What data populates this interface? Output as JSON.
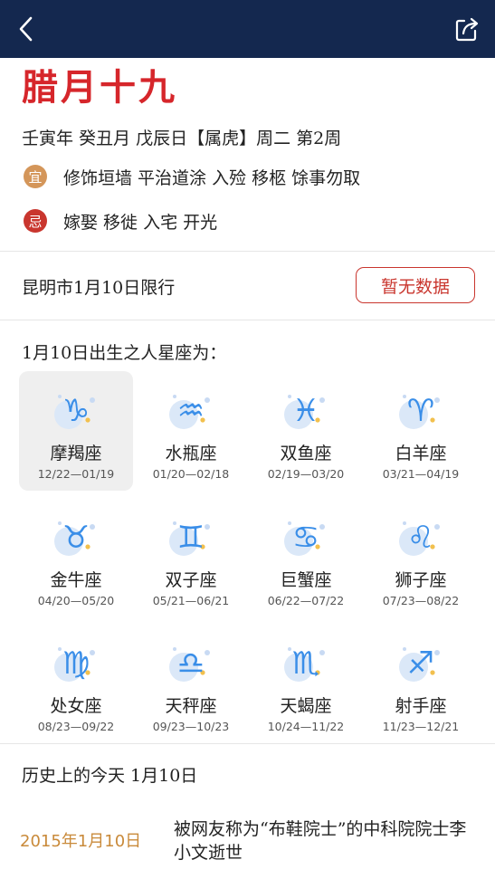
{
  "header": {
    "back_icon": "back-chevron-icon",
    "share_icon": "share-icon"
  },
  "almanac": {
    "lunar_date": "腊月十九",
    "ganzhi": "壬寅年 癸丑月 戊辰日【属虎】周二 第2周",
    "yi_label": "宜",
    "yi_text": "修饰垣墙 平治道涂 入殓 移柩 馀事勿取",
    "ji_label": "忌",
    "ji_text": "嫁娶 移徙 入宅 开光",
    "colors": {
      "lunar": "#d6262b",
      "yi": "#d4965a",
      "ji": "#c9362e"
    }
  },
  "traffic": {
    "text": "昆明市1月10日限行",
    "button": "暂无数据"
  },
  "zodiac": {
    "title": "1月10日出生之人星座为：",
    "items": [
      {
        "name": "摩羯座",
        "dates": "12/22—01/19",
        "symbol": "♑",
        "selected": true
      },
      {
        "name": "水瓶座",
        "dates": "01/20—02/18",
        "symbol": "♒"
      },
      {
        "name": "双鱼座",
        "dates": "02/19—03/20",
        "symbol": "♓"
      },
      {
        "name": "白羊座",
        "dates": "03/21—04/19",
        "symbol": "♈"
      },
      {
        "name": "金牛座",
        "dates": "04/20—05/20",
        "symbol": "♉"
      },
      {
        "name": "双子座",
        "dates": "05/21—06/21",
        "symbol": "♊"
      },
      {
        "name": "巨蟹座",
        "dates": "06/22—07/22",
        "symbol": "♋"
      },
      {
        "name": "狮子座",
        "dates": "07/23—08/22",
        "symbol": "♌"
      },
      {
        "name": "处女座",
        "dates": "08/23—09/22",
        "symbol": "♍"
      },
      {
        "name": "天秤座",
        "dates": "09/23—10/23",
        "symbol": "♎"
      },
      {
        "name": "天蝎座",
        "dates": "10/24—11/22",
        "symbol": "♏"
      },
      {
        "name": "射手座",
        "dates": "11/23—12/21",
        "symbol": "♐"
      }
    ]
  },
  "history": {
    "title": "历史上的今天 1月10日",
    "date": "2015年1月10日",
    "text": "被网友称为“布鞋院士”的中科院院士李小文逝世"
  }
}
